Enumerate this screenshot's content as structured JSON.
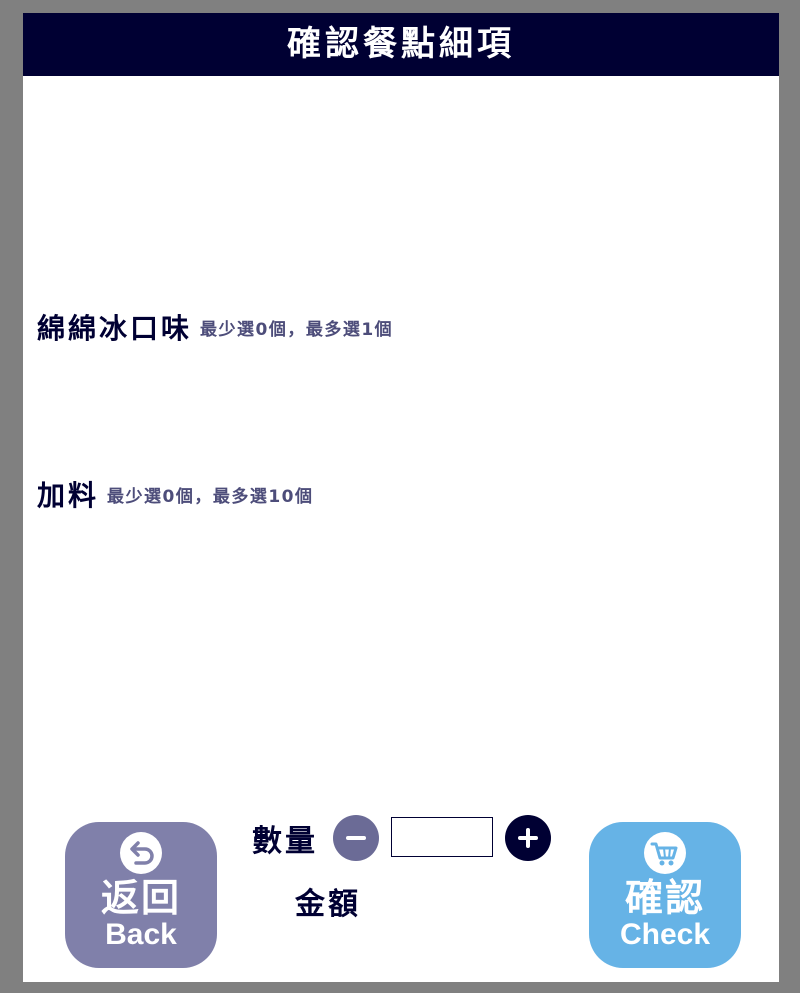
{
  "header": {
    "title": "確認餐點細項"
  },
  "sections": [
    {
      "title": "綿綿冰口味",
      "hint": "最少選0個，最多選1個"
    },
    {
      "title": "加料",
      "hint": "最少選0個，最多選10個"
    }
  ],
  "quantity": {
    "label": "數量",
    "value": ""
  },
  "amount": {
    "label": "金額"
  },
  "back_button": {
    "label_zh": "返回",
    "label_en": "Back",
    "icon": "return-arrow-icon"
  },
  "check_button": {
    "label_zh": "確認",
    "label_en": "Check",
    "icon": "cart-icon"
  },
  "colors": {
    "header_bg": "#000033",
    "back_button_bg": "#8080aa",
    "check_button_bg": "#66b3e6",
    "minus_button_bg": "#6b6b96",
    "plus_button_bg": "#000033",
    "page_bg": "#808080"
  }
}
